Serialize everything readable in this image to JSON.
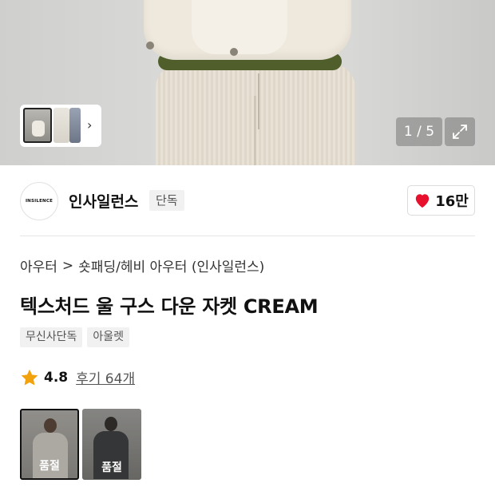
{
  "gallery": {
    "counter": "1 / 5",
    "thumb_arrow": "›"
  },
  "brand": {
    "logo_text": "INSILENCE",
    "name": "인사일런스",
    "tag": "단독",
    "like_count": "16만"
  },
  "breadcrumb": {
    "category": "아우터",
    "separator": ">",
    "subcategory": "숏패딩/헤비 아우터 (인사일런스)"
  },
  "product": {
    "title": "텍스처드 울 구스 다운 자켓 CREAM",
    "tags": [
      "무신사단독",
      "아울렛"
    ]
  },
  "rating": {
    "value": "4.8",
    "reviews": "후기 64개"
  },
  "options": [
    {
      "label": "품절",
      "selected": true
    },
    {
      "label": "품절",
      "selected": false
    }
  ],
  "icons": [
    "chevron-right-icon",
    "expand-icon",
    "heart-icon",
    "star-icon"
  ],
  "colors": {
    "heart": "#e8112d",
    "star": "#f2a20c",
    "tag_bg": "#f1f1f1"
  }
}
